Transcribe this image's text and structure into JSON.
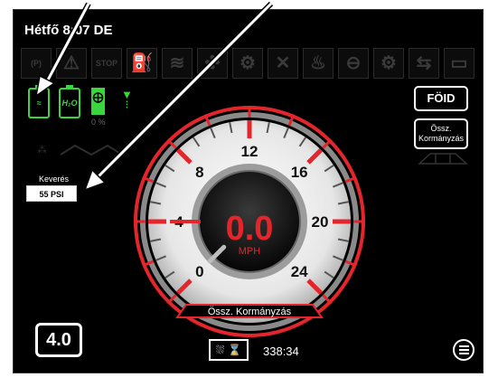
{
  "status": {
    "datetime": "Hétfő 8:07 DE"
  },
  "warning_icons": [
    {
      "name": "parking-brake-icon",
      "glyph": "(P)"
    },
    {
      "name": "warning-icon",
      "glyph": "⚠"
    },
    {
      "name": "stop-icon",
      "glyph": "STOP"
    },
    {
      "name": "fuel-icon",
      "glyph": "⛽"
    },
    {
      "name": "coolant-icon",
      "glyph": "≋"
    },
    {
      "name": "fan-fault-icon",
      "glyph": "✣"
    },
    {
      "name": "filter-icon",
      "glyph": "⚙"
    },
    {
      "name": "fan-off-icon",
      "glyph": "✕"
    },
    {
      "name": "oil-temp-icon",
      "glyph": "♨"
    },
    {
      "name": "engine-icon",
      "glyph": "⊖"
    },
    {
      "name": "gear-icon",
      "glyph": "⚙"
    },
    {
      "name": "transmission-icon",
      "glyph": "⇆"
    },
    {
      "name": "battery-icon",
      "glyph": "▭"
    }
  ],
  "tanks": {
    "left_label": "≈",
    "right_label": "H₂O"
  },
  "fan": {
    "percent": "0 %"
  },
  "mix": {
    "label": "Keverés",
    "value": "55 PSI"
  },
  "gauge": {
    "speed": "0.0",
    "unit": "MPH",
    "tick_labels": [
      "0",
      "4",
      "8",
      "12",
      "16",
      "20",
      "24"
    ],
    "mode_label": "Össz. Kormányzás",
    "needle_value": 0
  },
  "buttons": {
    "foid": "FÖID",
    "steer_line1": "Össz.",
    "steer_line2": "Kormányzás"
  },
  "speed_setting": "4.0",
  "timer": {
    "icon": "sprayer-hourglass-icon",
    "value": "338:34"
  },
  "colors": {
    "accent_red": "#e3262b",
    "tank_green": "#39d63e",
    "background": "#000000"
  }
}
